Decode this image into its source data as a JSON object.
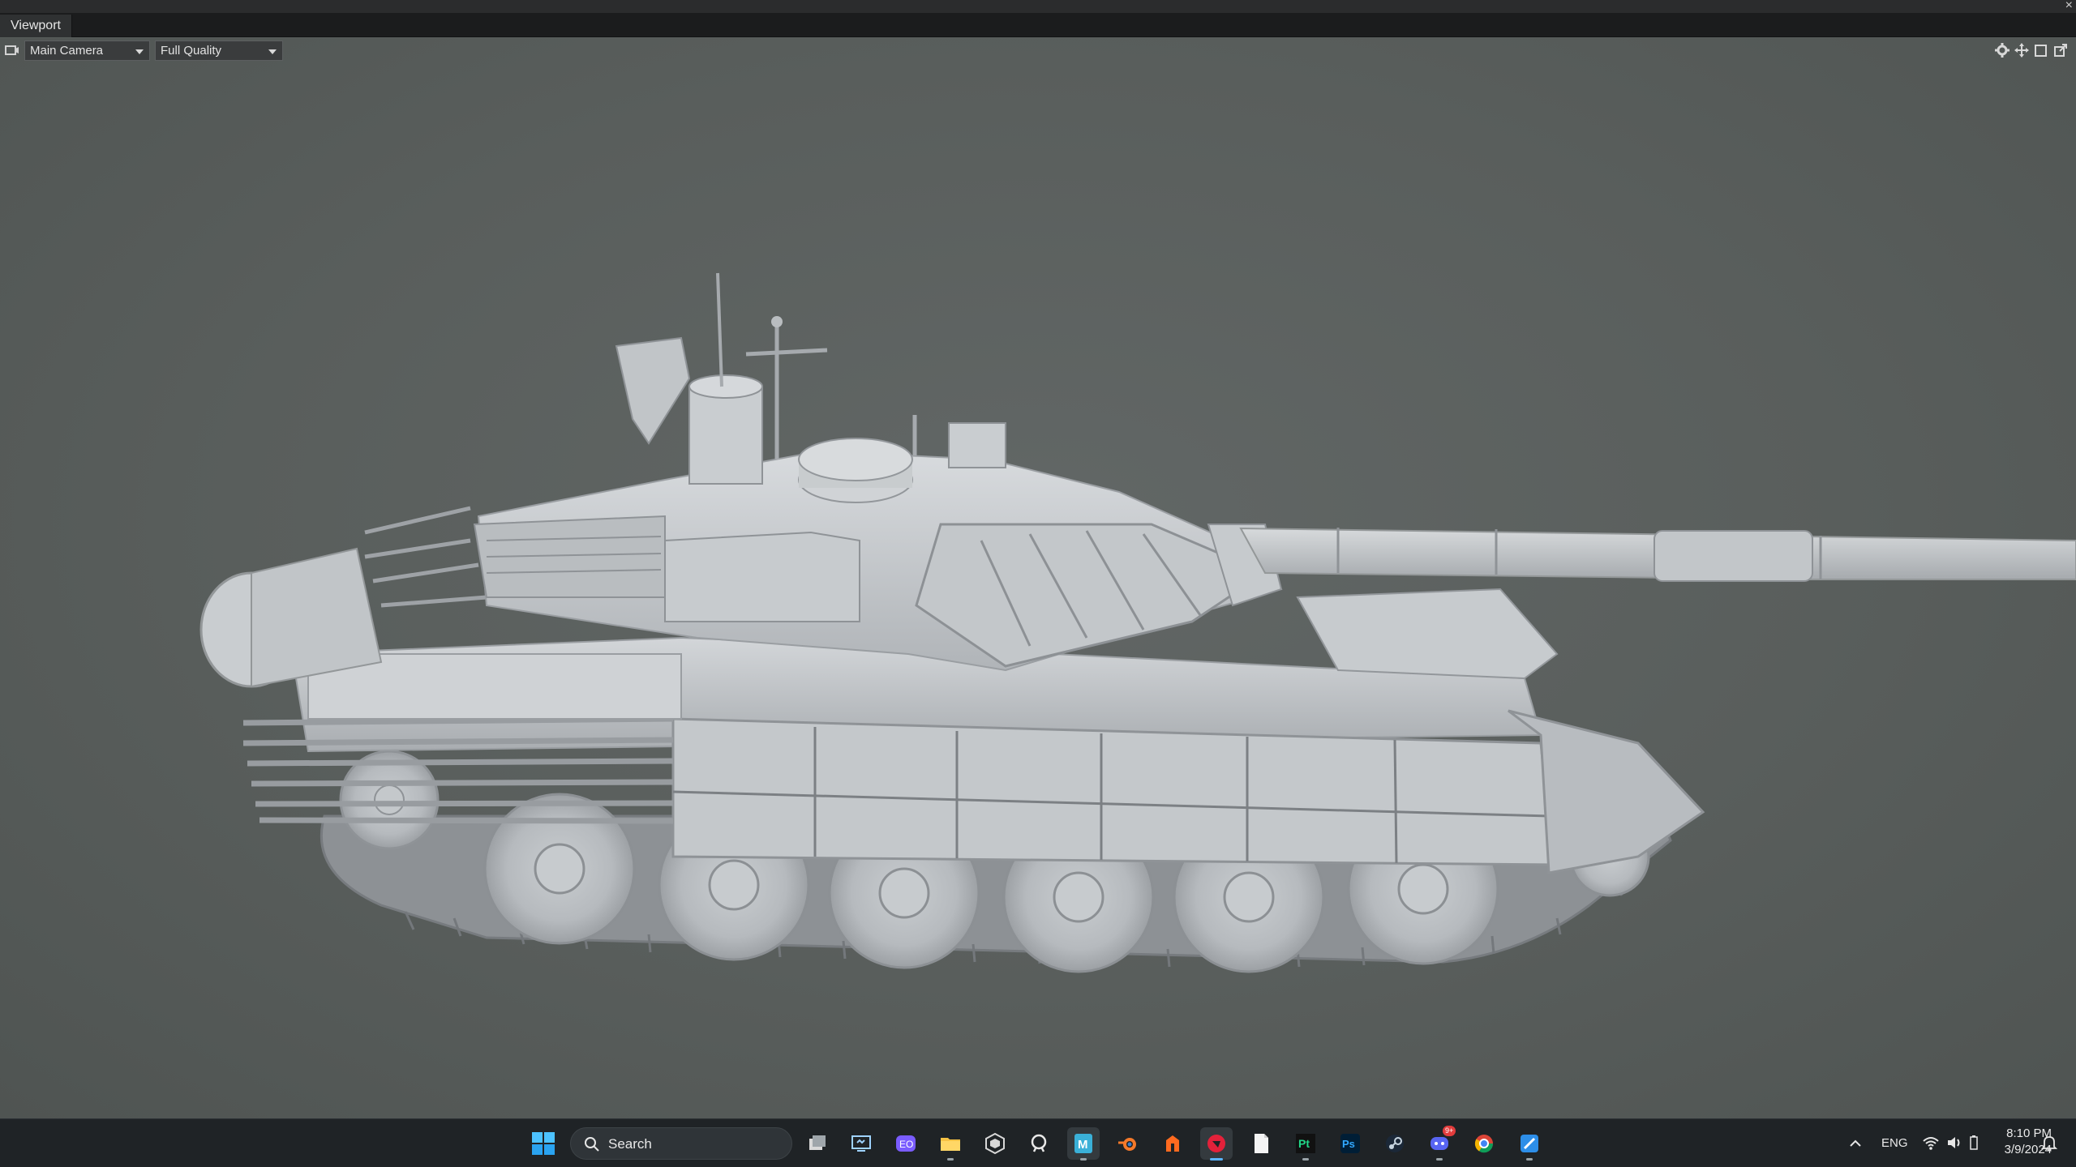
{
  "window": {
    "close_glyph": "×"
  },
  "tabs": [
    {
      "label": "Viewport",
      "active": true
    }
  ],
  "viewport": {
    "camera_select": {
      "value": "Main Camera"
    },
    "quality_select": {
      "value": "Full Quality"
    },
    "toolbar_icons": [
      "camera-options-icon",
      "gear-icon",
      "move-icon",
      "maximize-icon",
      "popout-icon"
    ],
    "background_color": "#595e5c",
    "model_color": "#bfc3c6"
  },
  "taskbar": {
    "search_placeholder": "Search",
    "pinned_apps": [
      "windows-start-icon",
      "task-view-icon",
      "remote-desktop-icon",
      "meta-quest-icon",
      "file-explorer-icon",
      "unity-icon",
      "github-desktop-icon",
      "marmoset-toolbag-icon",
      "blender-icon",
      "substance-icon",
      "substance-painter-icon",
      "notepad-icon",
      "pycharm-icon",
      "photoshop-icon",
      "steam-icon",
      "discord-icon",
      "chrome-icon",
      "snipping-tool-icon"
    ],
    "discord_badge": "9+",
    "tray": {
      "language": "ENG",
      "time": "8:10 PM",
      "date": "3/9/2024"
    }
  }
}
